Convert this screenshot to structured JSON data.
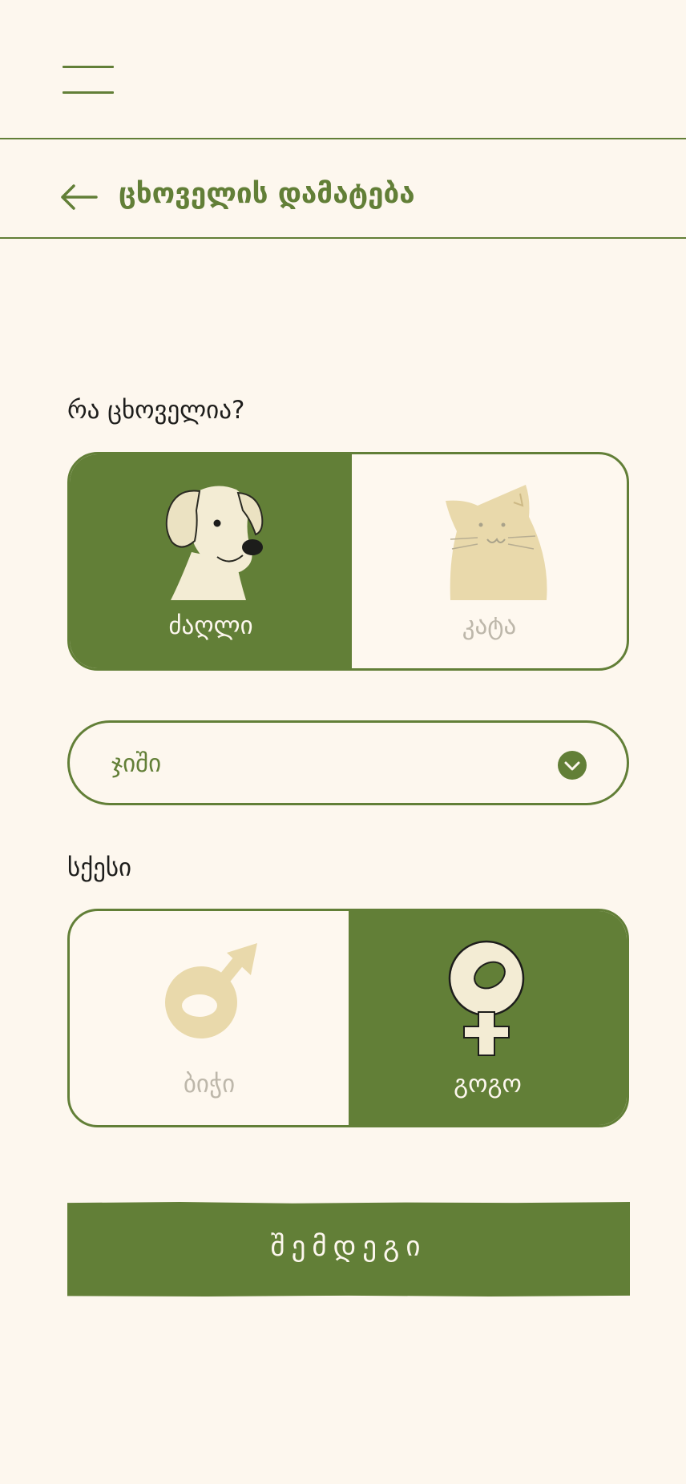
{
  "header": {
    "title": "ცხოველის დამატება"
  },
  "form": {
    "animal_question": "რა ცხოველია?",
    "animal_options": [
      {
        "label": "ძაღლი",
        "selected": true
      },
      {
        "label": "კატა",
        "selected": false
      }
    ],
    "breed": {
      "value": "ჯიში"
    },
    "sex_question": "სქესი",
    "sex_options": [
      {
        "label": "ბიჭი",
        "selected": false
      },
      {
        "label": "გოგო",
        "selected": true
      }
    ],
    "next_label": "შემდეგი"
  },
  "colors": {
    "primary": "#627f37",
    "background": "#fdf7ee",
    "illustration_light": "#f3ecd4",
    "illustration_muted": "#e9d9ab",
    "inactive_text": "#bdb7aa"
  }
}
